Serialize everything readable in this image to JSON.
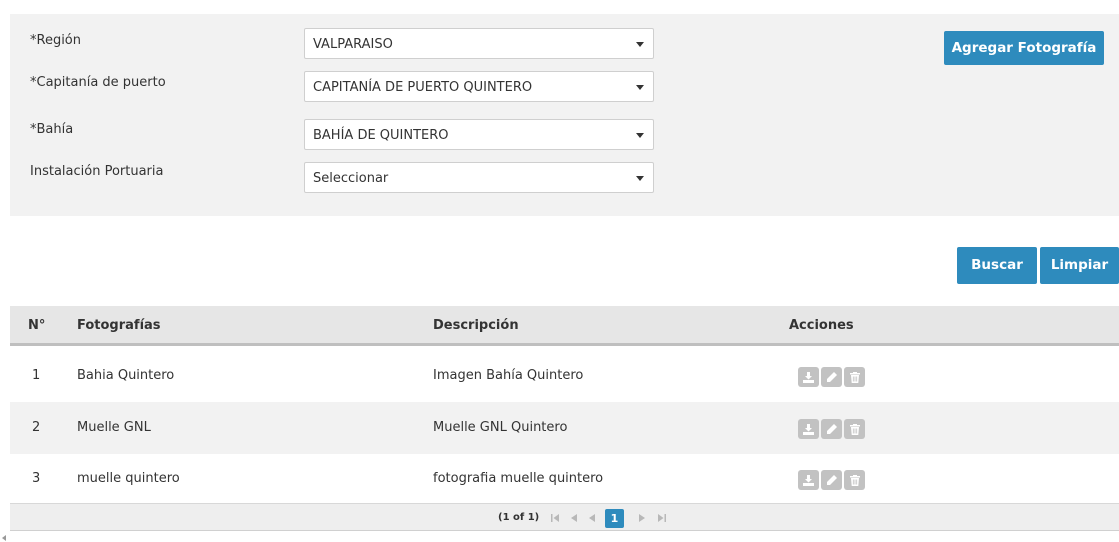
{
  "filters": {
    "region": {
      "label": "*Región",
      "value": "VALPARAISO"
    },
    "capitania": {
      "label": "*Capitanía de puerto",
      "value": "CAPITANÍA DE PUERTO QUINTERO"
    },
    "bahia": {
      "label": "*Bahía",
      "value": "BAHÍA DE QUINTERO"
    },
    "instalacion": {
      "label": "Instalación Portuaria",
      "value": "Seleccionar"
    }
  },
  "buttons": {
    "add_photo": "Agregar Fotografía",
    "search": "Buscar",
    "clear": "Limpiar"
  },
  "table": {
    "headers": [
      "N°",
      "Fotografías",
      "Descripción",
      "Acciones"
    ],
    "rows": [
      {
        "n": "1",
        "foto": "Bahia Quintero",
        "desc": "Imagen Bahía Quintero"
      },
      {
        "n": "2",
        "foto": "Muelle GNL",
        "desc": "Muelle GNL Quintero"
      },
      {
        "n": "3",
        "foto": "muelle quintero",
        "desc": "fotografia muelle quintero"
      }
    ],
    "action_icons": [
      "download-icon",
      "edit-icon",
      "delete-icon"
    ]
  },
  "pager": {
    "count": "(1 of 1)",
    "current": "1"
  },
  "colors": {
    "accent": "#2e8bbd",
    "panel": "#f2f2f2",
    "action_button": "#c2c2c2"
  }
}
